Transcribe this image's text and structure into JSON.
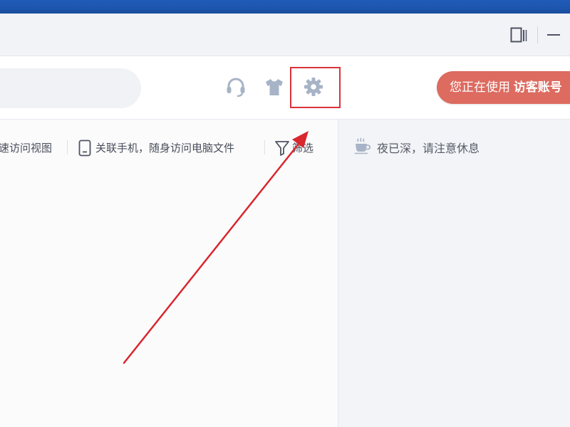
{
  "window": {
    "controls": [
      "layout-icon",
      "minimize-icon"
    ]
  },
  "toolbar": {
    "support_icon": "headset-icon",
    "skin_icon": "tshirt-icon",
    "settings_icon": "gear-icon",
    "visitor_prefix": "您正在使用",
    "visitor_account": "访客账号"
  },
  "quick_links": [
    {
      "label": "速访问视图",
      "icon": null
    },
    {
      "label": "关联手机，随身访问电脑文件",
      "icon": "phone-icon"
    },
    {
      "label": "筛选",
      "icon": "filter-icon"
    }
  ],
  "notice": {
    "icon": "coffee-cup-icon",
    "text": "夜已深，请注意休息"
  },
  "annotation": {
    "highlight_color": "#d9333a",
    "arrow_color": "#d9272e"
  },
  "colors": {
    "topbar": "#1f5bb8",
    "visitor_badge": "#dd6b60",
    "icon_gray": "#a7b3c6"
  }
}
